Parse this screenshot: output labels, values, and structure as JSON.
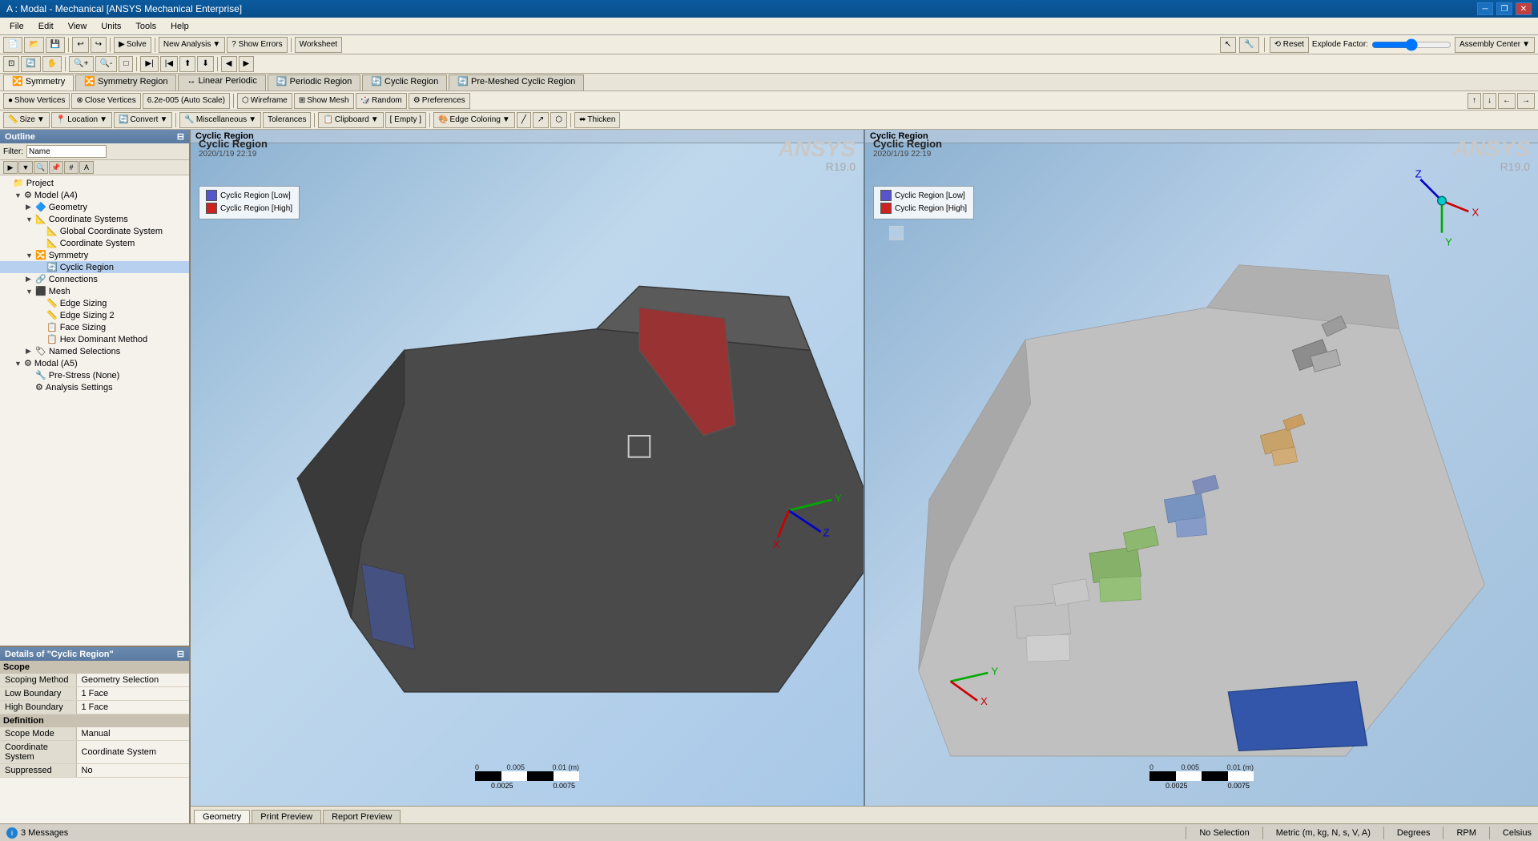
{
  "titlebar": {
    "title": "A : Modal - Mechanical [ANSYS Mechanical Enterprise]",
    "controls": [
      "minimize",
      "restore",
      "close"
    ]
  },
  "menubar": {
    "items": [
      "File",
      "Edit",
      "View",
      "Units",
      "Tools",
      "Help"
    ]
  },
  "toolbar1": {
    "solve_btn": "Solve",
    "new_analysis": "New Analysis",
    "show_errors": "? Show Errors",
    "worksheet": "Worksheet"
  },
  "symmetry_bar": {
    "tabs": [
      "Symmetry",
      "Symmetry Region",
      "Linear Periodic",
      "Periodic Region",
      "Cyclic Region",
      "Pre-Meshed Cyclic Region"
    ]
  },
  "toolbar3": {
    "show_vertices": "Show Vertices",
    "close_vertices": "Close Vertices",
    "scale_value": "6.2e-005 (Auto Scale)",
    "wireframe": "Wireframe",
    "show_mesh": "Show Mesh",
    "random": "Random",
    "preferences": "Preferences"
  },
  "toolbar4": {
    "size": "Size",
    "location": "Location",
    "convert": "Convert",
    "miscellaneous": "Miscellaneous",
    "tolerances": "Tolerances",
    "clipboard": "Clipboard",
    "empty": "[ Empty ]",
    "edge_coloring": "Edge Coloring",
    "thicken": "Thicken"
  },
  "outline": {
    "header": "Outline",
    "filter_label": "Filter:",
    "filter_value": "Name",
    "items": [
      {
        "indent": 0,
        "icon": "📁",
        "label": "Project",
        "arrow": "",
        "expanded": true
      },
      {
        "indent": 1,
        "icon": "⚙",
        "label": "Model (A4)",
        "arrow": "▼",
        "expanded": true
      },
      {
        "indent": 2,
        "icon": "🔷",
        "label": "Geometry",
        "arrow": "▶",
        "expanded": false
      },
      {
        "indent": 2,
        "icon": "📐",
        "label": "Coordinate Systems",
        "arrow": "▼",
        "expanded": true
      },
      {
        "indent": 3,
        "icon": "📐",
        "label": "Global Coordinate System",
        "arrow": "",
        "expanded": false
      },
      {
        "indent": 3,
        "icon": "📐",
        "label": "Coordinate System",
        "arrow": "",
        "expanded": false
      },
      {
        "indent": 2,
        "icon": "🔀",
        "label": "Symmetry",
        "arrow": "▼",
        "expanded": true
      },
      {
        "indent": 3,
        "icon": "🔄",
        "label": "Cyclic Region",
        "arrow": "",
        "expanded": false,
        "selected": true
      },
      {
        "indent": 2,
        "icon": "🔗",
        "label": "Connections",
        "arrow": "▶",
        "expanded": false
      },
      {
        "indent": 2,
        "icon": "⬛",
        "label": "Mesh",
        "arrow": "▼",
        "expanded": true
      },
      {
        "indent": 3,
        "icon": "📏",
        "label": "Edge Sizing",
        "arrow": "",
        "expanded": false
      },
      {
        "indent": 3,
        "icon": "📏",
        "label": "Edge Sizing 2",
        "arrow": "",
        "expanded": false
      },
      {
        "indent": 3,
        "icon": "📋",
        "label": "Face Sizing",
        "arrow": "",
        "expanded": false
      },
      {
        "indent": 3,
        "icon": "📋",
        "label": "Hex Dominant Method",
        "arrow": "",
        "expanded": false
      },
      {
        "indent": 2,
        "icon": "🏷",
        "label": "Named Selections",
        "arrow": "▶",
        "expanded": false
      },
      {
        "indent": 1,
        "icon": "⚙",
        "label": "Modal (A5)",
        "arrow": "▼",
        "expanded": true
      },
      {
        "indent": 2,
        "icon": "🔧",
        "label": "Pre-Stress (None)",
        "arrow": "",
        "expanded": false
      },
      {
        "indent": 2,
        "icon": "⚙",
        "label": "Analysis Settings",
        "arrow": "",
        "expanded": false
      }
    ]
  },
  "details": {
    "header": "Details of \"Cyclic Region\"",
    "sections": [
      {
        "name": "Scope",
        "rows": [
          {
            "label": "Scoping Method",
            "value": "Geometry Selection"
          },
          {
            "label": "Low Boundary",
            "value": "1 Face"
          },
          {
            "label": "High Boundary",
            "value": "1 Face"
          }
        ]
      },
      {
        "name": "Definition",
        "rows": [
          {
            "label": "Scope Mode",
            "value": "Manual"
          },
          {
            "label": "Coordinate System",
            "value": "Coordinate System"
          },
          {
            "label": "Suppressed",
            "value": "No"
          }
        ]
      }
    ]
  },
  "viewport_left": {
    "header": "Cyclic Region",
    "title": "Cyclic Region",
    "date": "2020/1/19 22:19",
    "legend": [
      {
        "color": "#5555cc",
        "label": "Cyclic Region [Low]"
      },
      {
        "color": "#cc2222",
        "label": "Cyclic Region [High]"
      }
    ],
    "scale_labels": [
      "0",
      "0.005",
      "0.01 (m)"
    ],
    "scale_sub": [
      "0.0025",
      "0.0075"
    ]
  },
  "viewport_right": {
    "header": "Cyclic Region",
    "title": "Cyclic Region",
    "date": "2020/1/19 22:19",
    "legend": [
      {
        "color": "#5555cc",
        "label": "Cyclic Region [Low]"
      },
      {
        "color": "#cc2222",
        "label": "Cyclic Region [High]"
      }
    ],
    "scale_labels": [
      "0",
      "0.005",
      "0.01 (m)"
    ],
    "scale_sub": [
      "0.0025",
      "0.0075"
    ]
  },
  "bottom_tabs": [
    {
      "label": "Geometry",
      "active": true
    },
    {
      "label": "Print Preview",
      "active": false
    },
    {
      "label": "Report Preview",
      "active": false
    }
  ],
  "statusbar": {
    "messages": "3 Messages",
    "selection": "No Selection",
    "units": "Metric (m, kg, N, s, V, A)",
    "degrees": "Degrees",
    "rpm": "RPM",
    "celsius": "Celsius"
  },
  "explode": {
    "label": "Explode Factor:",
    "assembly_center": "Assembly Center"
  }
}
